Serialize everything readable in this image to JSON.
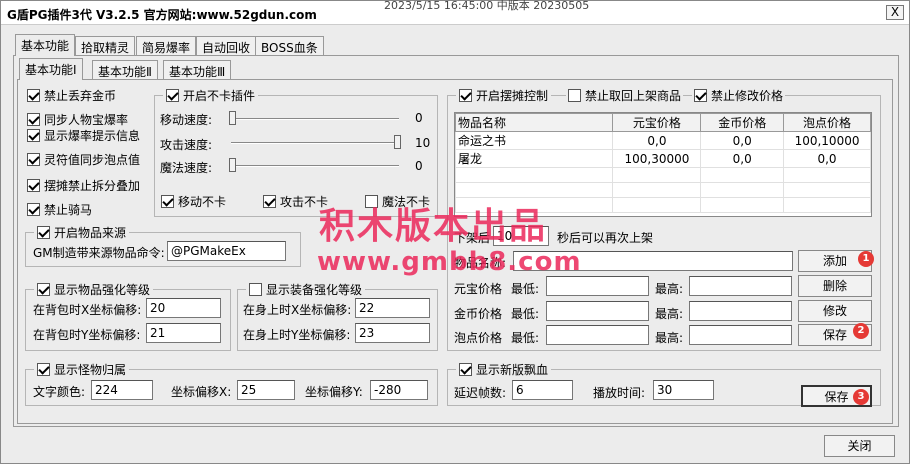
{
  "window": {
    "title": "G盾PG插件3代 V3.2.5  官方网站:www.52gdun.com",
    "title_extra": "2023/5/15 16:45:00 中版本 20230505",
    "close_glyph": "X"
  },
  "tabs_top": [
    "基本功能",
    "拾取精灵",
    "简易爆率",
    "自动回收",
    "BOSS血条"
  ],
  "tabs_sub": [
    "基本功能Ⅰ",
    "基本功能Ⅱ",
    "基本功能Ⅲ"
  ],
  "left_checks": [
    {
      "label": "禁止丢弃金币",
      "checked": true
    },
    {
      "label": "同步人物宝爆率",
      "checked": true
    },
    {
      "label": "显示爆率提示信息",
      "checked": true
    },
    {
      "label": "灵符值同步泡点值",
      "checked": true
    },
    {
      "label": "摆摊禁止拆分叠加",
      "checked": true
    },
    {
      "label": "禁止骑马",
      "checked": true
    }
  ],
  "nocard": {
    "title": "开启不卡插件",
    "checked": true,
    "sliders": [
      {
        "label": "移动速度:",
        "value": "0",
        "level": 0
      },
      {
        "label": "攻击速度:",
        "value": "10",
        "level": 1
      },
      {
        "label": "魔法速度:",
        "value": "0",
        "level": 0
      }
    ],
    "checks": [
      {
        "label": "移动不卡",
        "checked": true
      },
      {
        "label": "攻击不卡",
        "checked": true
      },
      {
        "label": "魔法不卡",
        "checked": false
      }
    ]
  },
  "source": {
    "title": "开启物品来源",
    "checked": true,
    "label": "GM制造带来源物品命令:",
    "value": "@PGMakeEx"
  },
  "enhance_bag": {
    "title": "显示物品强化等级",
    "checked": true,
    "x_label": "在背包时X坐标偏移:",
    "x_value": "20",
    "y_label": "在背包时Y坐标偏移:",
    "y_value": "21"
  },
  "enhance_equip": {
    "title": "显示装备强化等级",
    "checked": false,
    "x_label": "在身上时X坐标偏移:",
    "x_value": "22",
    "y_label": "在身上时Y坐标偏移:",
    "y_value": "23"
  },
  "monster": {
    "title": "显示怪物归属",
    "checked": true,
    "color_label": "文字颜色:",
    "color_value": "224",
    "x_label": "坐标偏移X:",
    "x_value": "25",
    "y_label": "坐标偏移Y:",
    "y_value": "-280"
  },
  "stall": {
    "title": "开启摆摊控制",
    "checked": true,
    "ban_takeback": {
      "label": "禁止取回上架商品",
      "checked": false
    },
    "ban_modify": {
      "label": "禁止修改价格",
      "checked": true
    },
    "columns": [
      "物品名称",
      "元宝价格",
      "金币价格",
      "泡点价格"
    ],
    "rows": [
      [
        "命运之书",
        "0,0",
        "0,0",
        "100,10000"
      ],
      [
        "屠龙",
        "100,30000",
        "0,0",
        "0,0"
      ]
    ],
    "delist_label": "下架后",
    "delist_value": "10",
    "delist_suffix": "秒后可以再次上架",
    "item_name_label": "物品名称:",
    "item_name_value": "",
    "price_rows": [
      {
        "label": "元宝价格",
        "min": "最低:",
        "max": "最高:"
      },
      {
        "label": "金币价格",
        "min": "最低:",
        "max": "最高:"
      },
      {
        "label": "泡点价格",
        "min": "最低:",
        "max": "最高:"
      }
    ],
    "buttons": {
      "add": "添加",
      "delete": "删除",
      "modify": "修改",
      "save": "保存"
    }
  },
  "newblood": {
    "title": "显示新版飘血",
    "checked": true,
    "delay_label": "延迟帧数:",
    "delay_value": "6",
    "time_label": "播放时间:",
    "time_value": "30"
  },
  "save_main": "保存",
  "close_button": "关闭",
  "badges": [
    "1",
    "2",
    "3"
  ],
  "watermark": {
    "line1": "积木版本出品",
    "line2": "www.gmbb8.com"
  }
}
